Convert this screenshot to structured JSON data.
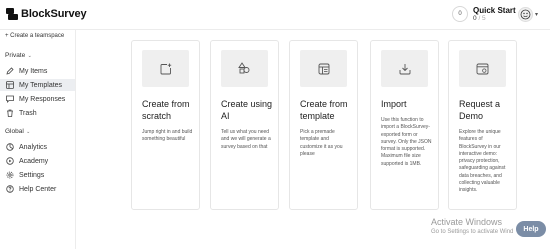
{
  "app": {
    "name": "BlockSurvey"
  },
  "quick_start": {
    "ring": "0",
    "title": "Quick Start",
    "done": "0",
    "sep_total": "/ 5"
  },
  "sidebar": {
    "create_teamspace": "+ Create a teamspace",
    "private_label": "Private",
    "private_items": [
      {
        "label": "My Items",
        "icon": "pen-icon"
      },
      {
        "label": "My Templates",
        "icon": "template-icon",
        "active": true
      },
      {
        "label": "My Responses",
        "icon": "responses-icon"
      },
      {
        "label": "Trash",
        "icon": "trash-icon"
      }
    ],
    "global_label": "Global",
    "global_items": [
      {
        "label": "Analytics",
        "icon": "analytics-icon"
      },
      {
        "label": "Academy",
        "icon": "academy-icon"
      },
      {
        "label": "Settings",
        "icon": "gear-icon"
      },
      {
        "label": "Help Center",
        "icon": "help-circle-icon"
      }
    ]
  },
  "cards": [
    {
      "title": "Create from scratch",
      "desc": "Jump right in and build something beautiful",
      "icon": "add-square-icon"
    },
    {
      "title": "Create using AI",
      "desc": "Tell us what you need and we will generate a survey based on that",
      "icon": "ai-shapes-icon"
    },
    {
      "title": "Create from template",
      "desc": "Pick a premade template and customize it as you please",
      "icon": "template-layout-icon"
    },
    {
      "title": "Import",
      "desc": "Use this function to import a BlockSurvey-exported form or survey. Only the JSON format is supported. Maximum file size supported is 1MB.",
      "icon": "import-icon"
    },
    {
      "title": "Request a Demo",
      "desc": "Explore the unique features of BlockSurvey in our interactive demo: privacy protection, safeguarding against data breaches, and collecting valuable insights.",
      "icon": "demo-browser-icon"
    }
  ],
  "watermark": {
    "title": "Activate Windows",
    "subtitle": "Go to Settings to activate Wind"
  },
  "help_button": {
    "label": "Help"
  }
}
